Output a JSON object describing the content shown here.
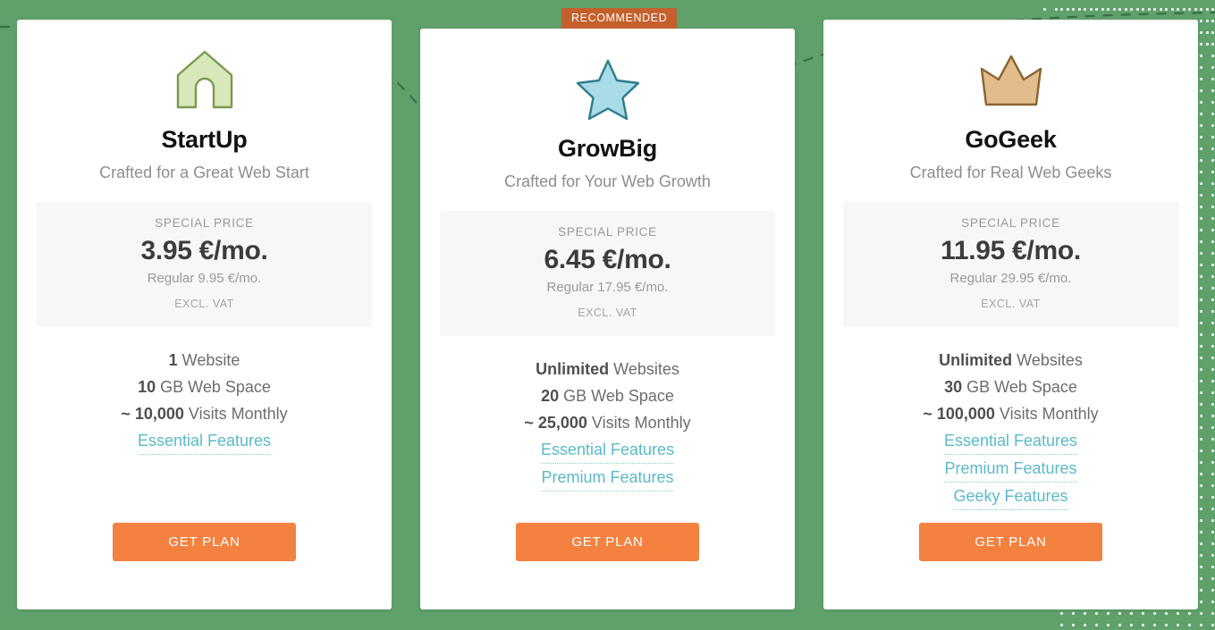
{
  "badge": {
    "label": "RECOMMENDED"
  },
  "theme": {
    "background_green": "#5fa06b",
    "card_white": "#ffffff",
    "cta_orange": "#f4813f",
    "badge_orange": "#c4602c",
    "link_teal": "#5bb9c9",
    "price_panel_grey": "#f7f7f7"
  },
  "plans": [
    {
      "icon": "house-icon",
      "icon_fill": "#d8e8bb",
      "icon_stroke": "#7a9a4e",
      "name": "StartUp",
      "tagline": "Crafted for a Great Web Start",
      "price": {
        "label": "SPECIAL PRICE",
        "amount": "3.95 €/mo.",
        "regular": "Regular 9.95 €/mo.",
        "vat": "EXCL. VAT"
      },
      "features": [
        {
          "strong": "1",
          "rest": " Website"
        },
        {
          "strong": "10",
          "rest": " GB Web Space"
        },
        {
          "strong": "~ 10,000",
          "rest": " Visits Monthly"
        }
      ],
      "links": [
        "Essential Features"
      ],
      "cta": "GET PLAN"
    },
    {
      "icon": "star-icon",
      "icon_fill": "#aadbe8",
      "icon_stroke": "#2e7d8c",
      "name": "GrowBig",
      "tagline": "Crafted for Your Web Growth",
      "price": {
        "label": "SPECIAL PRICE",
        "amount": "6.45 €/mo.",
        "regular": "Regular 17.95 €/mo.",
        "vat": "EXCL. VAT"
      },
      "features": [
        {
          "strong": "Unlimited",
          "rest": " Websites"
        },
        {
          "strong": "20",
          "rest": " GB Web Space"
        },
        {
          "strong": "~ 25,000",
          "rest": " Visits Monthly"
        }
      ],
      "links": [
        "Essential Features",
        "Premium Features"
      ],
      "cta": "GET PLAN"
    },
    {
      "icon": "crown-icon",
      "icon_fill": "#e3bc8d",
      "icon_stroke": "#8b6332",
      "name": "GoGeek",
      "tagline": "Crafted for Real Web Geeks",
      "price": {
        "label": "SPECIAL PRICE",
        "amount": "11.95 €/mo.",
        "regular": "Regular 29.95 €/mo.",
        "vat": "EXCL. VAT"
      },
      "features": [
        {
          "strong": "Unlimited",
          "rest": " Websites"
        },
        {
          "strong": "30",
          "rest": " GB Web Space"
        },
        {
          "strong": "~ 100,000",
          "rest": " Visits Monthly"
        }
      ],
      "links": [
        "Essential Features",
        "Premium Features",
        "Geeky Features"
      ],
      "cta": "GET PLAN"
    }
  ]
}
